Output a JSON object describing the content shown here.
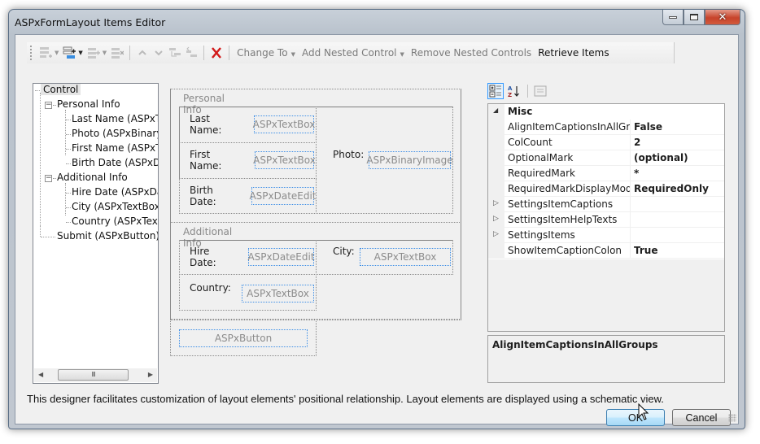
{
  "window": {
    "title": "ASPxFormLayout Items Editor",
    "caption_buttons": {
      "minimize": "minimize",
      "maximize": "maximize",
      "close": "close"
    }
  },
  "toolbar": {
    "icons": [
      {
        "name": "add-item-icon",
        "has_dropdown": true
      },
      {
        "name": "add-group-icon",
        "has_dropdown": true
      },
      {
        "name": "add-item-after-icon",
        "has_dropdown": true
      },
      {
        "name": "delete-item-icon",
        "has_dropdown": false
      },
      {
        "name": "move-up-icon",
        "has_dropdown": false
      },
      {
        "name": "move-down-icon",
        "has_dropdown": false
      },
      {
        "name": "indent-icon",
        "has_dropdown": false
      },
      {
        "name": "outdent-icon",
        "has_dropdown": false
      },
      {
        "name": "delete-icon",
        "has_dropdown": false
      }
    ],
    "change_to": "Change To",
    "add_nested_control": "Add Nested Control",
    "remove_nested_controls": "Remove Nested Controls",
    "retrieve_items": "Retrieve Items"
  },
  "tree": {
    "root": "Control",
    "groups": [
      {
        "label": "Personal Info",
        "items": [
          "Last Name (ASPxTextBox)",
          "Photo (ASPxBinaryImage)",
          "First Name (ASPxTextBox)",
          "Birth Date (ASPxDateEdit)"
        ]
      },
      {
        "label": "Additional Info",
        "items": [
          "Hire Date (ASPxDateEdit)",
          "City (ASPxTextBox)",
          "Country (ASPxTextBox)"
        ]
      }
    ],
    "last_item": "Submit (ASPxButton)",
    "scroll_thumb_glyph": "III"
  },
  "designer": {
    "personal_info": {
      "caption": "Personal Info",
      "last_name": {
        "label": "Last Name:",
        "control": "ASPxTextBox"
      },
      "first_name": {
        "label": "First Name:",
        "control": "ASPxTextBox"
      },
      "birth_date": {
        "label": "Birth Date:",
        "control": "ASPxDateEdit"
      },
      "photo": {
        "label": "Photo:",
        "control": "ASPxBinaryImage"
      }
    },
    "additional_info": {
      "caption": "Additional Info",
      "hire_date": {
        "label": "Hire Date:",
        "control": "ASPxDateEdit"
      },
      "city": {
        "label": "City:",
        "control": "ASPxTextBox"
      },
      "country": {
        "label": "Country:",
        "control": "ASPxTextBox"
      }
    },
    "submit": {
      "control": "ASPxButton"
    }
  },
  "property_grid": {
    "toolbar": [
      "categorized-icon",
      "alphabetical-icon",
      "property-pages-icon"
    ],
    "category": "Misc",
    "rows": [
      {
        "name": "AlignItemCaptionsInAllGroups",
        "value": "False",
        "expandable": false
      },
      {
        "name": "ColCount",
        "value": "2",
        "expandable": false
      },
      {
        "name": "OptionalMark",
        "value": "(optional)",
        "expandable": false
      },
      {
        "name": "RequiredMark",
        "value": "*",
        "expandable": false
      },
      {
        "name": "RequiredMarkDisplayMode",
        "value": "RequiredOnly",
        "expandable": false
      },
      {
        "name": "SettingsItemCaptions",
        "value": "",
        "expandable": true
      },
      {
        "name": "SettingsItemHelpTexts",
        "value": "",
        "expandable": true
      },
      {
        "name": "SettingsItems",
        "value": "",
        "expandable": true
      },
      {
        "name": "ShowItemCaptionColon",
        "value": "True",
        "expandable": false
      }
    ],
    "description_title": "AlignItemCaptionsInAllGroups"
  },
  "footer": {
    "info_text": "This designer facilitates customization of layout elements' positional relationship. Layout elements are displayed using a schematic view.",
    "ok_label": "OK",
    "cancel_label": "Cancel"
  }
}
